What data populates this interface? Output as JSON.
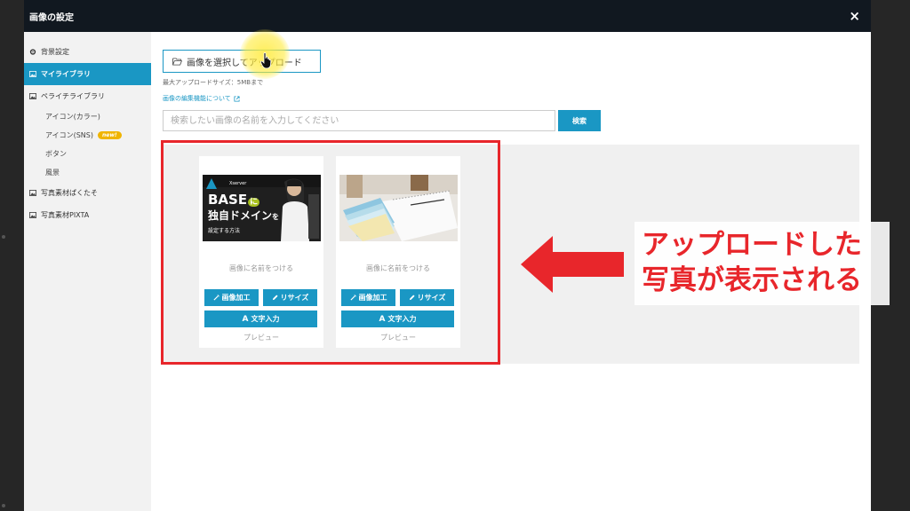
{
  "modal": {
    "title": "画像の設定",
    "close_glyph": "×"
  },
  "sidebar": {
    "items": [
      {
        "label": "背景設定",
        "icon": "gear-icon"
      },
      {
        "label": "マイライブラリ",
        "icon": "image-icon",
        "active": true
      },
      {
        "label": "ペライチライブラリ",
        "icon": "image-icon"
      },
      {
        "label": "アイコン(カラー)"
      },
      {
        "label": "アイコン(SNS)",
        "badge": "new!"
      },
      {
        "label": "ボタン"
      },
      {
        "label": "風景"
      },
      {
        "label": "写真素材ぱくたそ",
        "icon": "image-icon"
      },
      {
        "label": "写真素材PIXTA",
        "icon": "image-icon"
      }
    ]
  },
  "upload": {
    "button_label": "画像を選択してアップロード",
    "max_size_hint": "最大アップロードサイズ：5MBまで",
    "edit_link": "画像の編集機能について"
  },
  "search": {
    "placeholder": "検索したい画像の名前を入力してください",
    "button_label": "検索"
  },
  "cards": [
    {
      "thumb_title_line1": "BASE",
      "thumb_title_ni": "に",
      "thumb_title_line2": "独自ドメイン",
      "thumb_title_wo": "を",
      "thumb_subtitle": "設定する方法",
      "thumb_brand": "Xserver",
      "name_placeholder": "画像に名前をつける",
      "edit_label": "画像加工",
      "resize_label": "リサイズ",
      "text_label": "文字入力",
      "preview_label": "プレビュー"
    },
    {
      "name_placeholder": "画像に名前をつける",
      "edit_label": "画像加工",
      "resize_label": "リサイズ",
      "text_label": "文字入力",
      "preview_label": "プレビュー"
    }
  ],
  "annotation": {
    "line1": "アップロードした",
    "line2": "写真が表示される"
  },
  "colors": {
    "accent": "#1a97c4",
    "header": "#111820",
    "annotation_red": "#e8262b",
    "badge": "#f0b400"
  }
}
